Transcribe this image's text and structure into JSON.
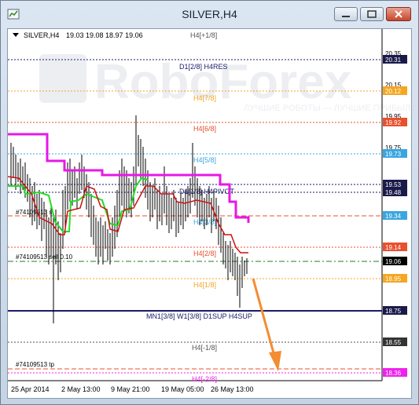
{
  "window": {
    "title": "SILVER,H4"
  },
  "header": {
    "symbol": "SILVER,H4",
    "ohlc": "19.03 19.08 18.97 19.06"
  },
  "watermark": "RoboForex",
  "watermark_tagline": "ЛУЧШИЕ РОБОТЫ — ЛУЧШИЕ ПРИБЫЛИ",
  "price_axis": [
    {
      "label": "20.35",
      "bg": "#ffffff",
      "color": "#000000"
    },
    {
      "label": "20.31",
      "bg": "#1a1a4a",
      "color": "#ffffff"
    },
    {
      "label": "20.15",
      "bg": "#ffffff",
      "color": "#000000"
    },
    {
      "label": "20.12",
      "bg": "#f5a623",
      "color": "#ffffff"
    },
    {
      "label": "19.95",
      "bg": "#ffffff",
      "color": "#000000"
    },
    {
      "label": "19.92",
      "bg": "#e8502e",
      "color": "#ffffff"
    },
    {
      "label": "19.75",
      "bg": "#ffffff",
      "color": "#000000"
    },
    {
      "label": "19.73",
      "bg": "#39a6e0",
      "color": "#ffffff"
    },
    {
      "label": "19.53",
      "bg": "#1a1a4a",
      "color": "#ffffff"
    },
    {
      "label": "19.48",
      "bg": "#1a1a4a",
      "color": "#ffffff"
    },
    {
      "label": "19.34",
      "bg": "#39a6e0",
      "color": "#ffffff"
    },
    {
      "label": "19.14",
      "bg": "#e8502e",
      "color": "#ffffff"
    },
    {
      "label": "19.06",
      "bg": "#000000",
      "color": "#ffffff"
    },
    {
      "label": "18.95",
      "bg": "#f5a623",
      "color": "#ffffff"
    },
    {
      "label": "18.75",
      "bg": "#1a1a4a",
      "color": "#ffffff"
    },
    {
      "label": "18.55",
      "bg": "#333333",
      "color": "#ffffff"
    },
    {
      "label": "18.36",
      "bg": "#ee22ee",
      "color": "#ffffff"
    }
  ],
  "levels": [
    {
      "text": "H4[+1/8]",
      "color": "#555555"
    },
    {
      "text": "D1[2/8] H4RES",
      "color": "#1a1a6a"
    },
    {
      "text": "H4[7/8]",
      "color": "#f5a623"
    },
    {
      "text": "H4[6/8]",
      "color": "#e8502e"
    },
    {
      "text": "H4[5/8]",
      "color": "#39a6e0"
    },
    {
      "text": "D1[1/8] H4PIVOT",
      "color": "#1a1a6a"
    },
    {
      "text": "H4[3/8]",
      "color": "#39a6e0"
    },
    {
      "text": "H4[2/8]",
      "color": "#e8502e"
    },
    {
      "text": "H4[1/8]",
      "color": "#f5a623"
    },
    {
      "text": "MN1[3/8] W1[3/8] D1SUP H4SUP",
      "color": "#1a1a6a"
    },
    {
      "text": "H4[-1/8]",
      "color": "#555555"
    },
    {
      "text": "H4[-2/8]",
      "color": "#ee22ee"
    }
  ],
  "orders": {
    "sl": "#74109513 sl",
    "sell": "#74109513 sell 0.10",
    "tp": "#74109513 tp"
  },
  "time_axis": [
    "25 Apr 2014",
    "2 May 13:00",
    "9 May 21:00",
    "19 May 05:00",
    "26 May 13:00"
  ]
}
